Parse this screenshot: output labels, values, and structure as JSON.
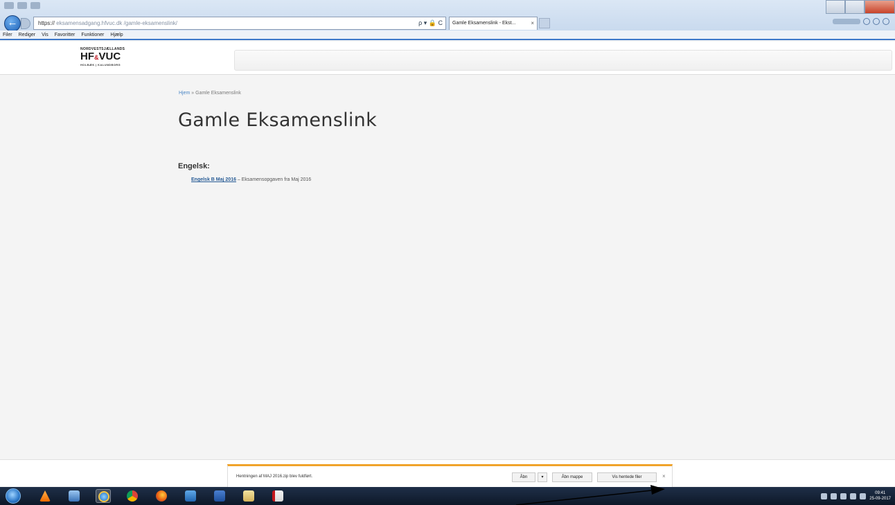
{
  "browser": {
    "url_prefix": "https://",
    "url_domain": "eksamensadgang.hfvuc.dk",
    "url_path": "/gamle-eksamenslink/",
    "address_tools": "ρ ▾ 🔒 C",
    "tab_title": "Gamle Eksamenslink - Ekst...",
    "tab_close": "×",
    "menu": [
      "Filer",
      "Rediger",
      "Vis",
      "Favoritter",
      "Funktioner",
      "Hjælp"
    ]
  },
  "site": {
    "logo_top": "NORDVESTSJÆLLANDS",
    "logo_main": "HF",
    "logo_amp": "&",
    "logo_main2": "VUC",
    "logo_sub": "HOLBÆK | KALUNDBORG"
  },
  "page": {
    "breadcrumb_home": "Hjem",
    "breadcrumb_sep": " » ",
    "breadcrumb_current": "Gamle Eksamenslink",
    "title": "Gamle Eksamenslink",
    "section_heading": "Engelsk:",
    "link_text": "Engelsk B Maj 2016",
    "link_desc": " – Eksamensopgaven fra Maj 2016"
  },
  "download": {
    "message": "Hentningen af MAJ 2016.zip blev fuldført.",
    "open_label": "Åbn",
    "dropdown_label": "▾",
    "open_folder_label": "Åbn mappe",
    "view_downloads_label": "Vis hentede filer",
    "close_label": "×"
  },
  "taskbar": {
    "apps": [
      "windows-media-player",
      "vlc",
      "photo-viewer",
      "internet-explorer",
      "chrome",
      "firefox",
      "calendar",
      "word",
      "file-explorer",
      "adobe-reader"
    ],
    "clock_time": "09:41",
    "clock_date": "25-09-2017"
  }
}
